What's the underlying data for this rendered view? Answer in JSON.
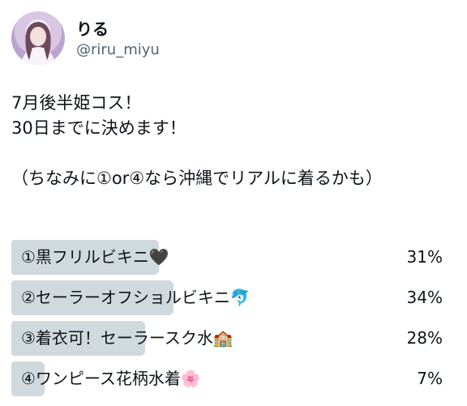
{
  "user": {
    "display_name": "りる",
    "handle": "@riru_miyu"
  },
  "tweet": {
    "lines": [
      "7月後半姫コス！",
      "30日までに決めます！",
      "",
      "（ちなみに①or④なら沖縄でリアルに着るかも）"
    ]
  },
  "poll": {
    "options": [
      {
        "label": "①黒フリルビキニ🖤",
        "percent_label": "31%",
        "percent": 31
      },
      {
        "label": "②セーラーオフショルビキニ🐬",
        "percent_label": "34%",
        "percent": 34
      },
      {
        "label": "③着衣可！セーラースク水🏫",
        "percent_label": "28%",
        "percent": 28
      },
      {
        "label": "④ワンピース花柄水着🌸",
        "percent_label": "7%",
        "percent": 7
      }
    ],
    "bar_color": "#cfd9de"
  }
}
